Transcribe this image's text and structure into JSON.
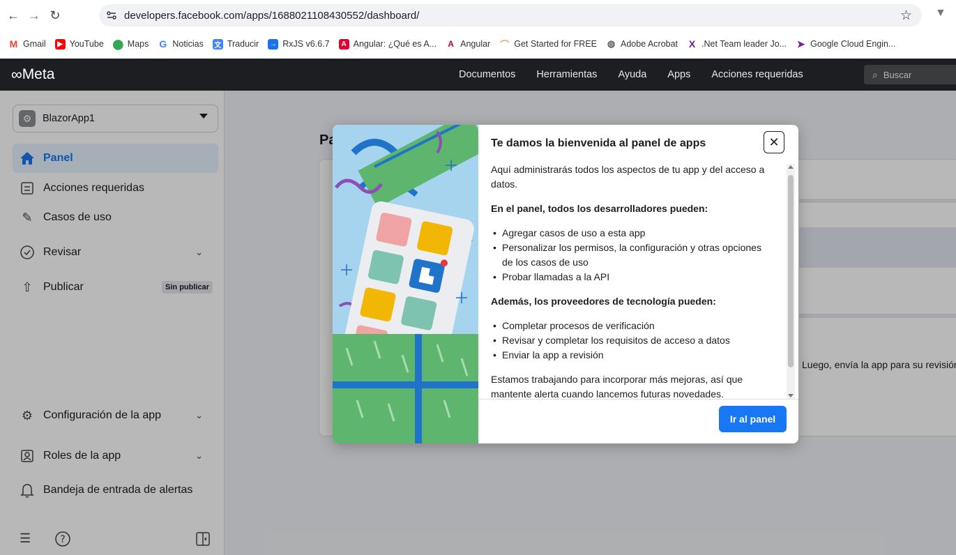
{
  "browser": {
    "url": "developers.facebook.com/apps/1688021108430552/dashboard/",
    "back_icon": "arrow-left-icon",
    "forward_icon": "arrow-right-icon",
    "reload_icon": "reload-icon",
    "bookmarks": [
      {
        "label": "Gmail",
        "icon": "gmail-icon",
        "color": "#ea4335"
      },
      {
        "label": "YouTube",
        "icon": "youtube-icon",
        "color": "#ff0000"
      },
      {
        "label": "Maps",
        "icon": "maps-icon",
        "color": "#34a853"
      },
      {
        "label": "Noticias",
        "icon": "google-icon",
        "color": "#4285f4"
      },
      {
        "label": "Traducir",
        "icon": "translate-icon",
        "color": "#4285f4"
      },
      {
        "label": "RxJS v6.6.7",
        "icon": "rxjs-icon",
        "color": "#1a73e8"
      },
      {
        "label": "Angular: ¿Qué es A...",
        "icon": "angular-icon",
        "color": "#dd0031"
      },
      {
        "label": "Angular",
        "icon": "angular-icon",
        "color": "#c3002f"
      },
      {
        "label": "Get Started for FREE",
        "icon": "rainbow-icon",
        "color": "#f4a261"
      },
      {
        "label": "Adobe Acrobat",
        "icon": "globe-icon",
        "color": "#5f6368"
      },
      {
        "label": ".Net Team leader Jo...",
        "icon": "x-logo-icon",
        "color": "#6a1b9a"
      },
      {
        "label": "Google Cloud Engin...",
        "icon": "play-icon",
        "color": "#7b1fa2"
      }
    ]
  },
  "meta_nav": {
    "logo": "Meta",
    "links": [
      "Documentos",
      "Herramientas",
      "Ayuda",
      "Apps",
      "Acciones requeridas"
    ],
    "search_placeholder": "Buscar"
  },
  "sidebar": {
    "app_name": "BlazorApp1",
    "items": [
      {
        "label": "Panel",
        "icon": "home-icon",
        "active": true
      },
      {
        "label": "Acciones requeridas",
        "icon": "checklist-icon"
      },
      {
        "label": "Casos de uso",
        "icon": "pencil-icon"
      },
      {
        "label": "Revisar",
        "icon": "shield-check-icon"
      },
      {
        "label": "Publicar",
        "icon": "upload-icon",
        "badge": "Sin publicar"
      },
      {
        "label": "Configuración de la app",
        "icon": "gear-icon"
      },
      {
        "label": "Roles de la app",
        "icon": "user-badge-icon"
      },
      {
        "label": "Bandeja de entrada de alertas",
        "icon": "bell-icon"
      }
    ]
  },
  "main": {
    "heading_partial": "Pa",
    "peek_text": "Luego, envía la app para su revisión"
  },
  "modal": {
    "title": "Te damos la bienvenida al panel de apps",
    "intro": "Aquí administrarás todos los aspectos de tu app y del acceso a datos.",
    "section1_title": "En el panel, todos los desarrolladores pueden:",
    "section1_items": [
      "Agregar casos de uso a esta app",
      "Personalizar los permisos, la configuración y otras opciones de los casos de uso",
      "Probar llamadas a la API"
    ],
    "section2_title": "Además, los proveedores de tecnología pueden:",
    "section2_items": [
      "Completar procesos de verificación",
      "Revisar y completar los requisitos de acceso a datos",
      "Enviar la app a revisión"
    ],
    "closing": "Estamos trabajando para incorporar más mejoras, así que mantente alerta cuando lancemos futuras novedades.",
    "button": "Ir al panel",
    "close_icon": "close-icon"
  },
  "colors": {
    "accent": "#1877f2",
    "nav_bg": "#1c1e21",
    "page_bg": "#f0f2f5"
  }
}
